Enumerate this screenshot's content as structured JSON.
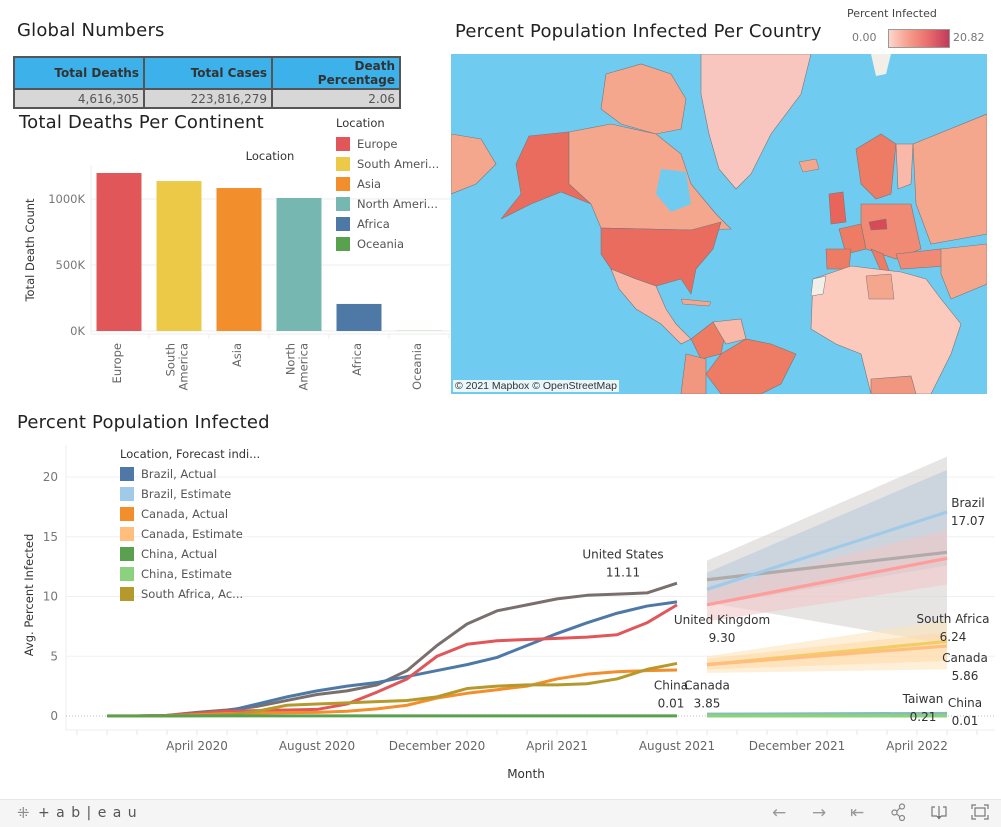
{
  "global_numbers": {
    "title": "Global Numbers",
    "headers": [
      "Total Deaths",
      "Total Cases",
      "Death Percentage"
    ],
    "values": [
      "4,616,305",
      "223,816,279",
      "2.06"
    ],
    "header_color": "#3db1ea"
  },
  "map": {
    "title": "Percent Population Infected Per Country",
    "legend_title": "Percent Infected",
    "legend_min": "0.00",
    "legend_max": "20.82",
    "attribution": "© 2021 Mapbox  © OpenStreetMap",
    "water_color": "#6fcbef"
  },
  "toolbar": {
    "brand": "+ a b | e a u",
    "icons": [
      "undo-icon",
      "redo-icon",
      "revert-icon",
      "share-icon",
      "download-icon",
      "fullscreen-icon"
    ]
  },
  "chart_data": [
    {
      "type": "bar",
      "title": "Total Deaths Per Continent",
      "column_header": "Location",
      "xlabel": "",
      "ylabel": "Total Death Count",
      "categories": [
        "Europe",
        "South America",
        "Asia",
        "North America",
        "Africa",
        "Oceania"
      ],
      "category_labels": [
        [
          "Europe"
        ],
        [
          "South",
          "America"
        ],
        [
          "Asia"
        ],
        [
          "North",
          "America"
        ],
        [
          "Africa"
        ],
        [
          "Oceania"
        ]
      ],
      "values": [
        1197000,
        1136000,
        1083000,
        1008000,
        205000,
        1300
      ],
      "colors": [
        "#e15759",
        "#edc948",
        "#f28e2b",
        "#76b7b2",
        "#4e79a7",
        "#59a14f"
      ],
      "yticks": [
        0,
        500000,
        1000000
      ],
      "ytick_labels": [
        "0K",
        "500K",
        "1000K"
      ],
      "ylim": [
        0,
        1200000
      ],
      "grid": true,
      "legend": {
        "title": "Location",
        "placement": "right",
        "items": [
          "Europe",
          "South Ameri...",
          "Asia",
          "North Ameri...",
          "Africa",
          "Oceania"
        ]
      }
    },
    {
      "type": "line",
      "title": "Percent Population Infected",
      "xlabel": "Month",
      "ylabel": "Avg. Percent Infected",
      "ylim": [
        0,
        22
      ],
      "yticks": [
        0,
        5,
        10,
        15,
        20
      ],
      "x_start": "January 2020",
      "x_months": 29,
      "xtick_labels": [
        {
          "month_index": 3,
          "label": "April 2020"
        },
        {
          "month_index": 7,
          "label": "August 2020"
        },
        {
          "month_index": 11,
          "label": "December 2020"
        },
        {
          "month_index": 15,
          "label": "April 2021"
        },
        {
          "month_index": 19,
          "label": "August 2021"
        },
        {
          "month_index": 23,
          "label": "December 2021"
        },
        {
          "month_index": 27,
          "label": "April 2022"
        }
      ],
      "grid": true,
      "legend": {
        "title": "Location, Forecast indi...",
        "placement": "top-left",
        "items": [
          {
            "label": "Brazil, Actual",
            "color": "#4e79a7"
          },
          {
            "label": "Brazil, Estimate",
            "color": "#a0cbe8"
          },
          {
            "label": "Canada, Actual",
            "color": "#f28e2b"
          },
          {
            "label": "Canada, Estimate",
            "color": "#ffbe7d"
          },
          {
            "label": "China, Actual",
            "color": "#59a14f"
          },
          {
            "label": "China, Estimate",
            "color": "#8cd17d"
          },
          {
            "label": "South Africa, Ac...",
            "color": "#b6992d"
          }
        ]
      },
      "series": [
        {
          "name": "United States, Actual",
          "color": "#79706e",
          "start": 0,
          "values": [
            0,
            0,
            0.05,
            0.3,
            0.5,
            0.8,
            1.3,
            1.8,
            2.1,
            2.6,
            3.8,
            5.9,
            7.7,
            8.8,
            9.3,
            9.8,
            10.1,
            10.2,
            10.3,
            11.11
          ]
        },
        {
          "name": "Brazil, Actual",
          "color": "#4e79a7",
          "start": 1,
          "values": [
            0,
            0.01,
            0.05,
            0.4,
            1.0,
            1.6,
            2.1,
            2.5,
            2.8,
            3.3,
            3.8,
            4.3,
            4.9,
            5.9,
            6.9,
            7.8,
            8.6,
            9.2,
            9.55
          ]
        },
        {
          "name": "United Kingdom, Actual",
          "color": "#e15759",
          "start": 0,
          "values": [
            0,
            0,
            0.05,
            0.2,
            0.4,
            0.45,
            0.5,
            0.55,
            1.0,
            2.0,
            3.1,
            5.0,
            6.0,
            6.3,
            6.4,
            6.5,
            6.6,
            6.8,
            7.8,
            9.3
          ]
        },
        {
          "name": "Canada, Actual",
          "color": "#f28e2b",
          "start": 0,
          "values": [
            0,
            0,
            0.02,
            0.1,
            0.2,
            0.25,
            0.28,
            0.3,
            0.4,
            0.6,
            0.9,
            1.5,
            1.9,
            2.2,
            2.5,
            3.1,
            3.5,
            3.7,
            3.8,
            3.85
          ]
        },
        {
          "name": "South Africa, Actual",
          "color": "#b6992d",
          "start": 2,
          "values": [
            0,
            0.02,
            0.1,
            0.4,
            0.9,
            1.0,
            1.1,
            1.2,
            1.3,
            1.6,
            2.3,
            2.5,
            2.6,
            2.6,
            2.7,
            3.1,
            3.9,
            4.4
          ]
        },
        {
          "name": "China, Actual",
          "color": "#59a14f",
          "start": 0,
          "values": [
            0.01,
            0.01,
            0.01,
            0.01,
            0.01,
            0.01,
            0.01,
            0.01,
            0.01,
            0.01,
            0.01,
            0.01,
            0.01,
            0.01,
            0.01,
            0.01,
            0.01,
            0.01,
            0.01,
            0.01
          ]
        }
      ],
      "forecasts": [
        {
          "name": "United States, Estimate",
          "color": "#b0aaa8",
          "band_color": "#d4cfcd",
          "start": 20,
          "end": 28,
          "from": 11.4,
          "to": 13.7,
          "lo_from": 9.5,
          "lo_to": 6.0,
          "hi_from": 13.0,
          "hi_to": 21.7
        },
        {
          "name": "Brazil, Estimate",
          "color": "#a0cbe8",
          "band_color": "#b7c9d9",
          "start": 20,
          "end": 28,
          "from": 10.6,
          "to": 17.07,
          "lo_from": 9.2,
          "lo_to": 12.6,
          "hi_from": 12.0,
          "hi_to": 20.6
        },
        {
          "name": "United Kingdom, Estimate",
          "color": "#ff9d9a",
          "band_color": "#f2c4c4",
          "start": 20,
          "end": 28,
          "from": 9.3,
          "to": 13.2,
          "lo_from": 7.9,
          "lo_to": 11.0,
          "hi_from": 10.5,
          "hi_to": 15.6
        },
        {
          "name": "South Africa, Estimate",
          "color": "#f1ce63",
          "band_color": "#fde3b8",
          "start": 20,
          "end": 28,
          "from": 4.3,
          "to": 6.24,
          "lo_from": 3.6,
          "lo_to": 3.9,
          "hi_from": 5.0,
          "hi_to": 8.0
        },
        {
          "name": "Canada, Estimate",
          "color": "#ffbe7d",
          "band_color": "#ffd9a8",
          "start": 20,
          "end": 28,
          "from": 4.3,
          "to": 5.86,
          "lo_from": 3.9,
          "lo_to": 4.6,
          "hi_from": 4.8,
          "hi_to": 7.0
        },
        {
          "name": "Taiwan, Estimate",
          "color": "#86bcb6",
          "band_color": "#cde6e2",
          "start": 20,
          "end": 28,
          "from": 0.15,
          "to": 0.21,
          "lo_from": 0.1,
          "lo_to": 0.1,
          "hi_from": 0.2,
          "hi_to": 0.3
        },
        {
          "name": "China, Estimate",
          "color": "#8cd17d",
          "band_color": "#cdeac4",
          "start": 20,
          "end": 28,
          "from": 0.01,
          "to": 0.01,
          "lo_from": 0.0,
          "lo_to": 0.0,
          "hi_from": 0.05,
          "hi_to": 0.05
        }
      ],
      "annotations": [
        {
          "name": "United States",
          "value": "11.11",
          "month_index": 17.2,
          "y": 13.2
        },
        {
          "name": "United Kingdom",
          "value": "9.30",
          "month_index": 20.5,
          "y": 7.7
        },
        {
          "name": "China",
          "value": "0.01",
          "month_index": 18.8,
          "y": 2.2
        },
        {
          "name": "Canada",
          "value": "3.85",
          "month_index": 20.0,
          "y": 2.2
        },
        {
          "name": "Brazil",
          "value": "17.07",
          "month_index": 28.7,
          "y": 17.5
        },
        {
          "name": "South Africa",
          "value": "6.24",
          "month_index": 28.2,
          "y": 7.8
        },
        {
          "name": "Canada",
          "value": "5.86",
          "month_index": 28.6,
          "y": 4.5
        },
        {
          "name": "Taiwan",
          "value": "0.21",
          "month_index": 27.2,
          "y": 1.1
        },
        {
          "name": "China",
          "value": "0.01",
          "month_index": 28.6,
          "y": 0.75
        }
      ]
    }
  ]
}
